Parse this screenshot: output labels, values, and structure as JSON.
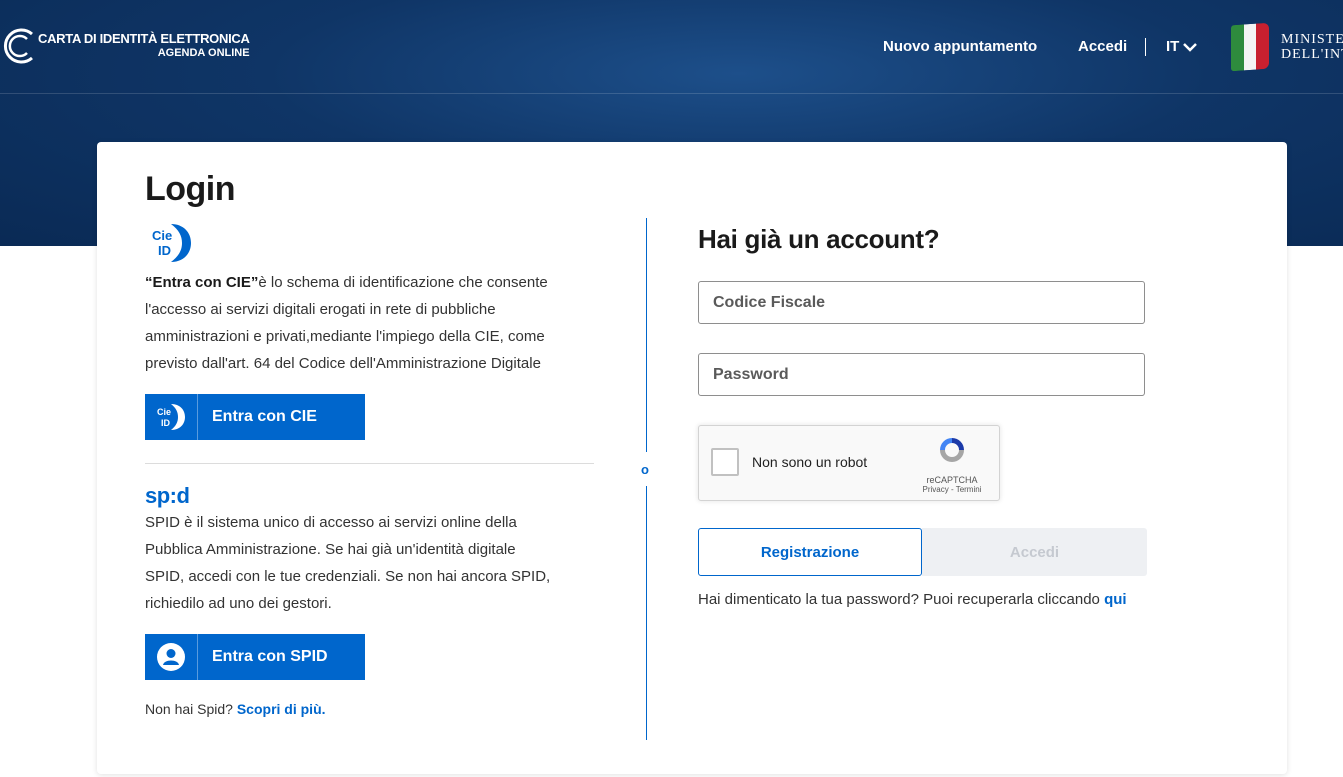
{
  "header": {
    "brand_line1": "CARTA DI IDENTITÀ ELETTRONICA",
    "brand_line2": "AGENDA ONLINE",
    "nav_new_appointment": "Nuovo appuntamento",
    "nav_login": "Accedi",
    "language": "IT",
    "ministry_line1": "MINISTE",
    "ministry_line2": "DELL'INT"
  },
  "login": {
    "title": "Login",
    "cie_logo_text": "Cie ID",
    "cie_description_bold": "“Entra con CIE”",
    "cie_description": "è lo schema di identificazione che consente l'accesso ai servizi digitali erogati in rete di pubbliche amministrazioni e privati,mediante l'impiego della CIE, come previsto dall'art. 64 del Codice dell'Amministrazione Digitale",
    "cie_button": "Entra con CIE",
    "spid_logo": "sp:d",
    "spid_description": "SPID è il sistema unico di accesso ai servizi online della Pubblica Amministrazione. Se hai già un'identità digitale SPID, accedi con le tue credenziali. Se non hai ancora SPID, richiedilo ad uno dei gestori.",
    "spid_button": "Entra con SPID",
    "no_spid_text": "Non hai Spid?",
    "no_spid_link": "Scopri di più."
  },
  "divider_label": "o",
  "account": {
    "title": "Hai già un account?",
    "fiscal_code_placeholder": "Codice Fiscale",
    "password_placeholder": "Password",
    "captcha_label": "Non sono un robot",
    "captcha_brand": "reCAPTCHA",
    "captcha_links": "Privacy - Termini",
    "register_button": "Registrazione",
    "login_button": "Accedi",
    "forgot_text": "Hai dimenticato la tua password? Puoi recuperarla cliccando",
    "forgot_link": "qui"
  },
  "colors": {
    "primary": "#0066cc",
    "header_bg": "#0f3566",
    "flag_green": "#2e8b3d",
    "flag_red": "#c8202f"
  }
}
